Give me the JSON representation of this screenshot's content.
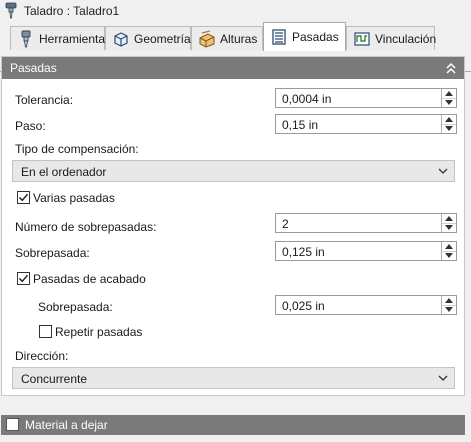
{
  "window": {
    "title": "Taladro : Taladro1",
    "app_icon": "drill-icon"
  },
  "tabs": [
    {
      "label": "Herramienta",
      "icon": "drill-tool-icon",
      "active": false
    },
    {
      "label": "Geometría",
      "icon": "cube-geometry-icon",
      "active": false
    },
    {
      "label": "Alturas",
      "icon": "heights-icon",
      "active": false
    },
    {
      "label": "Pasadas",
      "icon": "passes-icon",
      "active": true
    },
    {
      "label": "Vinculación",
      "icon": "linking-icon",
      "active": false
    }
  ],
  "panel": {
    "title": "Pasadas",
    "collapse_icon": "double-chevron-up-icon",
    "tolerance": {
      "label": "Tolerancia:",
      "value": "0,0004 in"
    },
    "step": {
      "label": "Paso:",
      "value": "0,15 in"
    },
    "compensation": {
      "label": "Tipo de compensación:",
      "value": "En el ordenador"
    },
    "multiple_passes": {
      "label": "Varias pasadas",
      "checked": true
    },
    "stepover_count": {
      "label": "Número de sobrepasadas:",
      "value": "2"
    },
    "stepover": {
      "label": "Sobrepasada:",
      "value": "0,125 in"
    },
    "finishing_passes": {
      "label": "Pasadas de acabado",
      "checked": true
    },
    "finishing_stepover": {
      "label": "Sobrepasada:",
      "value": "0,025 in"
    },
    "repeat_passes": {
      "label": "Repetir pasadas",
      "checked": false
    },
    "direction": {
      "label": "Dirección:",
      "value": "Concurrente"
    }
  },
  "stock_to_leave": {
    "label": "Material a dejar",
    "checked": false
  },
  "colors": {
    "header_bg": "#7a7a7a",
    "panel_bg": "#ffffff",
    "window_bg": "#f0f0f0",
    "icon_blue": "#3a6fb0",
    "icon_orange": "#e3a23a"
  }
}
